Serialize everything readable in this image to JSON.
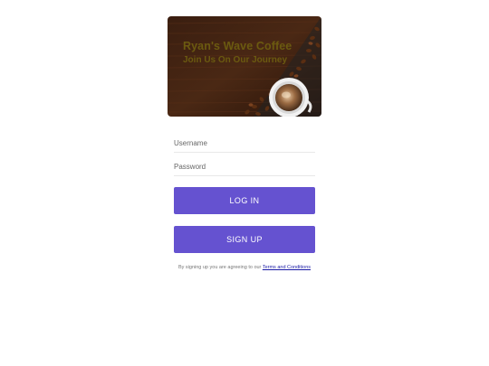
{
  "hero": {
    "title": "Ryan's Wave Coffee",
    "subtitle": "Join Us On Our Journey",
    "image_icon": "coffee-cup-with-beans"
  },
  "login_form": {
    "username_placeholder": "Username",
    "password_placeholder": "Password",
    "username_value": "",
    "password_value": "",
    "login_label": "LOG IN",
    "signup_label": "SIGN UP"
  },
  "terms": {
    "text": "By signing up you are agreeing to our ",
    "link_label": "Terms and Conditions"
  },
  "colors": {
    "accent": "#6552d0",
    "hero_text": "#6b5a10",
    "link": "#1a1aa6"
  }
}
